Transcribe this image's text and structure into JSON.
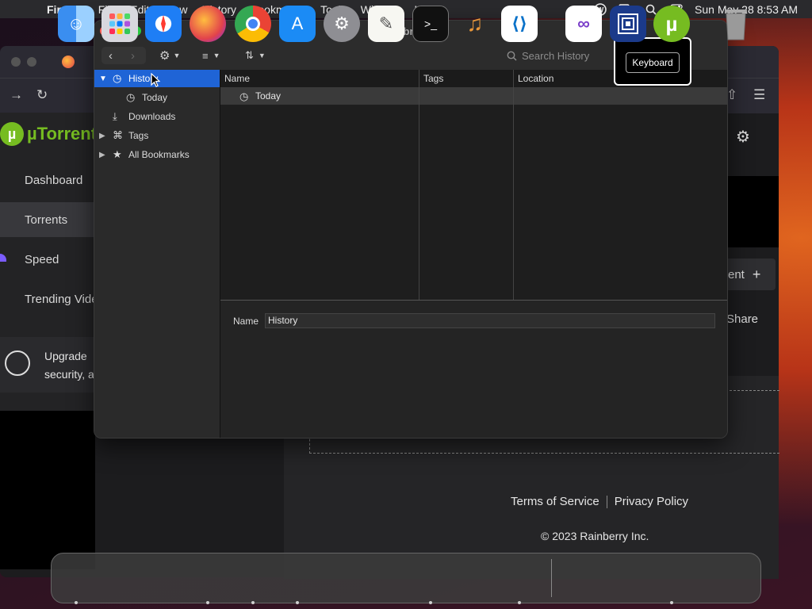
{
  "menubar": {
    "app_name": "Firefox",
    "menus": [
      "File",
      "Edit",
      "View",
      "History",
      "Bookmarks",
      "Tools",
      "Window",
      "Help"
    ],
    "datetime": "Sun May 28  8:53 AM",
    "status_icons": [
      "wordpress-icon",
      "screen-mirroring-icon",
      "spotlight-search-icon",
      "control-center-icon"
    ]
  },
  "background_app": {
    "brand": "µTorrent",
    "nav": [
      "Dashboard",
      "Torrents",
      "Speed",
      "Trending Vide"
    ],
    "upgrade_line1": "Upgrade",
    "upgrade_line2": "security, a",
    "add_label": "ent",
    "share_label": "Share",
    "footer": {
      "terms": "Terms of Service",
      "privacy": "Privacy Policy",
      "copyright": "© 2023 Rainberry Inc."
    }
  },
  "library": {
    "title": "Library",
    "search_placeholder": "Search History",
    "sidebar": [
      {
        "label": "History",
        "expanded": true,
        "selected": true
      },
      {
        "label": "Today"
      },
      {
        "label": "Downloads"
      },
      {
        "label": "Tags"
      },
      {
        "label": "All Bookmarks"
      }
    ],
    "columns": [
      "Name",
      "Tags",
      "Location"
    ],
    "rows": [
      {
        "name": "Today",
        "tags": "",
        "location": ""
      }
    ],
    "detail": {
      "name_label": "Name",
      "name_value": "History"
    }
  },
  "tooltip": {
    "label": "Keyboard"
  },
  "dock": {
    "apps": [
      "Finder",
      "Launchpad",
      "Safari",
      "Firefox",
      "Chrome",
      "App Store",
      "System Settings",
      "TextEdit",
      "Terminal",
      "GarageBand",
      "VS Code",
      "Visual Studio",
      "Remote Desktop",
      "µTorrent",
      "Trash"
    ]
  },
  "colors": {
    "selection": "#1f64d6",
    "utorrent_green": "#76bc21",
    "close": "#ff5f57",
    "minimize": "#febc2e",
    "zoom": "#28c840"
  }
}
